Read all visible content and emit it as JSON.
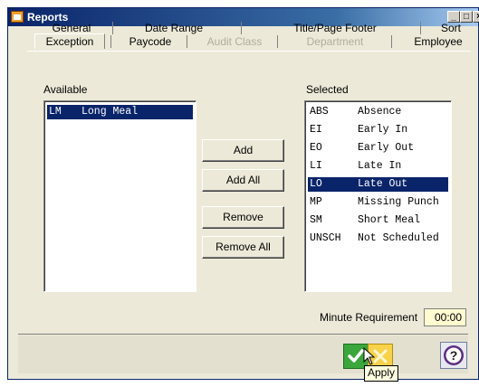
{
  "window": {
    "title": "Reports"
  },
  "tabs_row1": [
    {
      "label": "General",
      "enabled": true
    },
    {
      "label": "Date Range",
      "enabled": true
    },
    {
      "label": "Title/Page Footer",
      "enabled": true
    },
    {
      "label": "Sort",
      "enabled": true
    }
  ],
  "tabs_row2": [
    {
      "label": "Exception",
      "enabled": true,
      "active": true
    },
    {
      "label": "Paycode",
      "enabled": true
    },
    {
      "label": "Audit Class",
      "enabled": false
    },
    {
      "label": "Department",
      "enabled": false
    },
    {
      "label": "Employee",
      "enabled": true
    }
  ],
  "available": {
    "label": "Available",
    "items": [
      {
        "code": "LM",
        "desc": "Long Meal",
        "selected": true
      }
    ]
  },
  "selected": {
    "label": "Selected",
    "items": [
      {
        "code": "ABS",
        "desc": "Absence",
        "selected": false
      },
      {
        "code": "EI",
        "desc": "Early In",
        "selected": false
      },
      {
        "code": "EO",
        "desc": "Early Out",
        "selected": false
      },
      {
        "code": "LI",
        "desc": "Late In",
        "selected": false
      },
      {
        "code": "LO",
        "desc": "Late Out",
        "selected": true
      },
      {
        "code": "MP",
        "desc": "Missing Punch",
        "selected": false
      },
      {
        "code": "SM",
        "desc": "Short Meal",
        "selected": false
      },
      {
        "code": "UNSCH",
        "desc": "Not Scheduled",
        "selected": false
      }
    ]
  },
  "buttons": {
    "add": "Add",
    "add_all": "Add All",
    "remove": "Remove",
    "remove_all": "Remove All"
  },
  "minute_requirement": {
    "label": "Minute Requirement",
    "value": "00:00"
  },
  "tooltip": "Apply",
  "icons": {
    "ok": "check-icon",
    "cancel": "cancel-icon",
    "help": "help-icon",
    "app": "reports-icon"
  },
  "colors": {
    "selection": "#0a246a",
    "minute_field": "#fffbd1",
    "title_bar": "#0a246a"
  }
}
